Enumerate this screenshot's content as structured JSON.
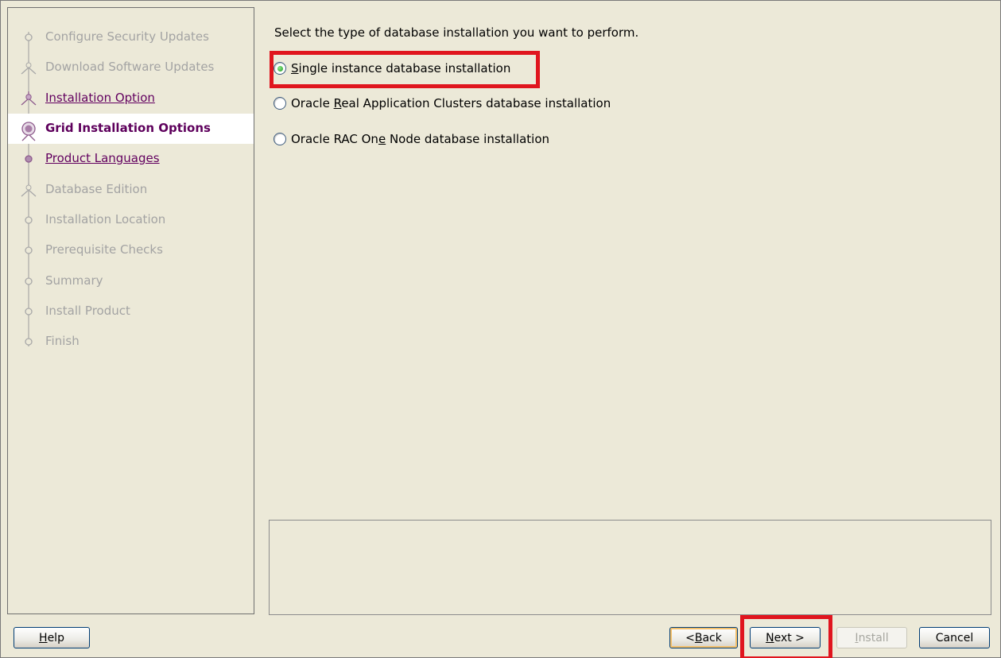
{
  "steps": [
    {
      "label": "Configure Security Updates",
      "state": "disabled",
      "marker": "dot-icon"
    },
    {
      "label": "Download Software Updates",
      "state": "disabled",
      "marker": "fork-icon"
    },
    {
      "label": "Installation Option",
      "state": "link",
      "marker": "fork-icon"
    },
    {
      "label": "Grid Installation Options",
      "state": "current",
      "marker": "current-step-icon"
    },
    {
      "label": "Product Languages",
      "state": "link",
      "marker": "dot-icon"
    },
    {
      "label": "Database Edition",
      "state": "disabled",
      "marker": "fork-icon"
    },
    {
      "label": "Installation Location",
      "state": "disabled",
      "marker": "dot-icon"
    },
    {
      "label": "Prerequisite Checks",
      "state": "disabled",
      "marker": "dot-icon"
    },
    {
      "label": "Summary",
      "state": "disabled",
      "marker": "dot-icon"
    },
    {
      "label": "Install Product",
      "state": "disabled",
      "marker": "dot-icon"
    },
    {
      "label": "Finish",
      "state": "disabled",
      "marker": "end-icon"
    }
  ],
  "main": {
    "prompt": "Select the type of database installation you want to perform.",
    "options": [
      {
        "pre": "",
        "mnemonic": "S",
        "post": "ingle instance database installation",
        "checked": true
      },
      {
        "pre": "Oracle ",
        "mnemonic": "R",
        "post": "eal Application Clusters database installation",
        "checked": false
      },
      {
        "pre": "Oracle RAC On",
        "mnemonic": "e",
        "post": " Node database installation",
        "checked": false
      }
    ]
  },
  "buttons": {
    "help": {
      "mnemonic": "H",
      "rest": "elp"
    },
    "back": {
      "pre": "< ",
      "mnemonic": "B",
      "rest": "ack"
    },
    "next": {
      "mnemonic": "N",
      "rest": "ext >"
    },
    "install": {
      "mnemonic": "I",
      "rest": "nstall"
    },
    "cancel": "Cancel"
  },
  "colors": {
    "highlight": "#e0151e",
    "link": "#62005f",
    "disabled_text": "#a3a3a3"
  }
}
